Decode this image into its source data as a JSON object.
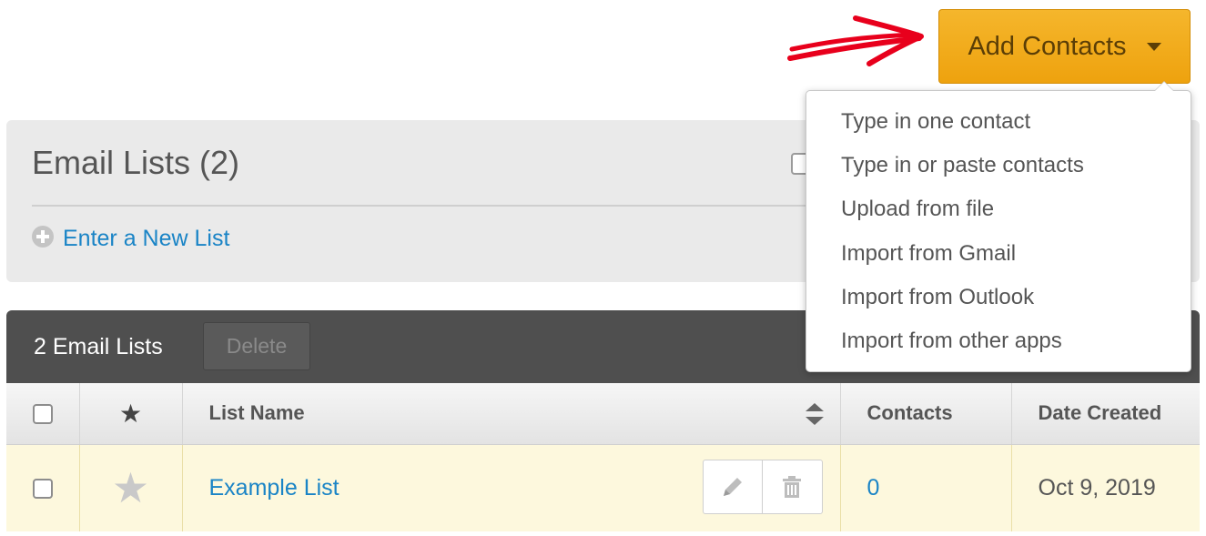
{
  "header": {
    "add_contacts_label": "Add Contacts"
  },
  "add_contacts_menu": {
    "items": [
      {
        "label": "Type in one contact"
      },
      {
        "label": "Type in or paste contacts"
      },
      {
        "label": "Upload from file"
      },
      {
        "label": "Import from Gmail"
      },
      {
        "label": "Import from Outlook"
      },
      {
        "label": "Import from other apps"
      }
    ]
  },
  "lists_panel": {
    "title": "Email Lists (2)",
    "new_list_label": "Enter a New List"
  },
  "toolbar": {
    "count_label": "2 Email Lists",
    "delete_label": "Delete"
  },
  "table": {
    "columns": {
      "list_name": "List Name",
      "contacts": "Contacts",
      "date_created": "Date Created"
    },
    "rows": [
      {
        "name": "Example List",
        "contacts": "0",
        "date_created": "Oct 9, 2019"
      }
    ]
  },
  "colors": {
    "accent_button": "#eea20e",
    "link": "#1a84c6",
    "toolbar": "#4f4f4f",
    "row_highlight": "#fdf8dd",
    "annotation_arrow": "#e8001c"
  },
  "icons": [
    "plus-circle-icon",
    "caret-down-icon",
    "star-icon",
    "sort-icon",
    "pencil-icon",
    "trash-icon"
  ]
}
